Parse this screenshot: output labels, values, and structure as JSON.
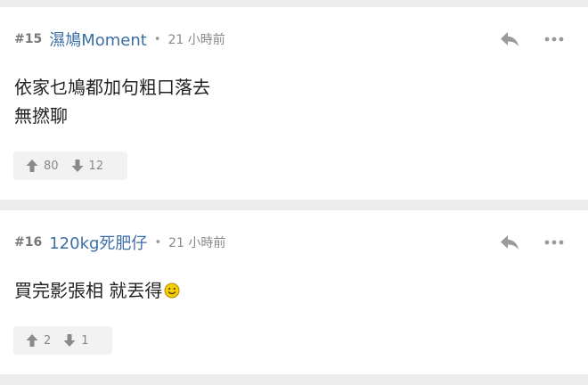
{
  "posts": [
    {
      "number": "#15",
      "username": "濕鳩Moment",
      "separator": "•",
      "time": "21 小時前",
      "body_lines": [
        "依家乜鳩都加句粗口落去",
        "無撚聊"
      ],
      "upvotes": "80",
      "downvotes": "12"
    },
    {
      "number": "#16",
      "username": "120kg死肥仔",
      "separator": "•",
      "time": "21 小時前",
      "body_lines": [
        "買完影張相 就丟得"
      ],
      "upvotes": "2",
      "downvotes": "1",
      "body_emoji": "smiley-face-icon"
    }
  ],
  "icons": {
    "reply": "reply-arrow-icon",
    "more": "more-dots-icon",
    "upvote": "thumb-up-arrow-icon",
    "downvote": "down-arrow-icon"
  },
  "colors": {
    "background": "#ececec",
    "card": "#ffffff",
    "username": "#3c6ea6",
    "meta": "#888888",
    "body_text": "#222222",
    "icon": "#9a9a9a",
    "vote_bg": "#f2f2f2",
    "emoji": "#f5d000"
  }
}
